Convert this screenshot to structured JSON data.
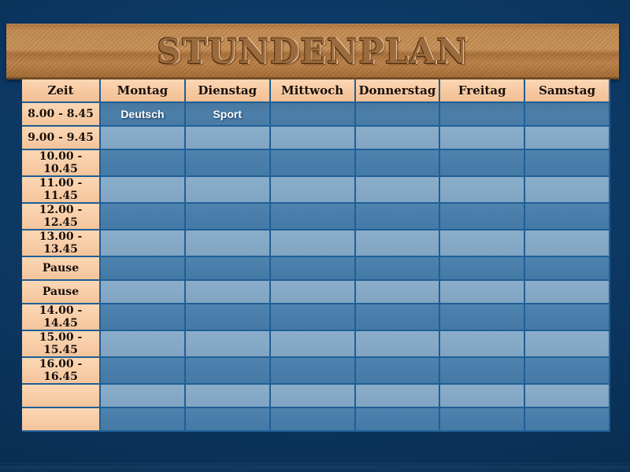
{
  "slide": {
    "background_color": "#0a3157",
    "banner_color": "#b5773f",
    "accent_peach": "#f8cda7",
    "cell_dark_blue": "#4a7daa",
    "cell_light_blue": "#86a9c6",
    "grid_line_color": "#1f5f96"
  },
  "title": "STUNDENPLAN",
  "table": {
    "columns": [
      "Zeit",
      "Montag",
      "Dienstag",
      "Mittwoch",
      "Donnerstag",
      "Freitag",
      "Samstag"
    ],
    "rows": [
      {
        "time": "8.00 - 8.45",
        "cells": [
          "Deutsch",
          "Sport",
          "",
          "",
          "",
          ""
        ]
      },
      {
        "time": "9.00 - 9.45",
        "cells": [
          "",
          "",
          "",
          "",
          "",
          ""
        ]
      },
      {
        "time": "10.00 - 10.45",
        "cells": [
          "",
          "",
          "",
          "",
          "",
          ""
        ]
      },
      {
        "time": "11.00 - 11.45",
        "cells": [
          "",
          "",
          "",
          "",
          "",
          ""
        ]
      },
      {
        "time": "12.00 - 12.45",
        "cells": [
          "",
          "",
          "",
          "",
          "",
          ""
        ]
      },
      {
        "time": "13.00 - 13.45",
        "cells": [
          "",
          "",
          "",
          "",
          "",
          ""
        ]
      },
      {
        "time": "Pause",
        "cells": [
          "",
          "",
          "",
          "",
          "",
          ""
        ]
      },
      {
        "time": "Pause",
        "cells": [
          "",
          "",
          "",
          "",
          "",
          ""
        ]
      },
      {
        "time": "14.00 - 14.45",
        "cells": [
          "",
          "",
          "",
          "",
          "",
          ""
        ]
      },
      {
        "time": "15.00 - 15.45",
        "cells": [
          "",
          "",
          "",
          "",
          "",
          ""
        ]
      },
      {
        "time": "16.00 - 16.45",
        "cells": [
          "",
          "",
          "",
          "",
          "",
          ""
        ]
      },
      {
        "time": "",
        "cells": [
          "",
          "",
          "",
          "",
          "",
          ""
        ]
      },
      {
        "time": "",
        "cells": [
          "",
          "",
          "",
          "",
          "",
          ""
        ]
      }
    ]
  }
}
